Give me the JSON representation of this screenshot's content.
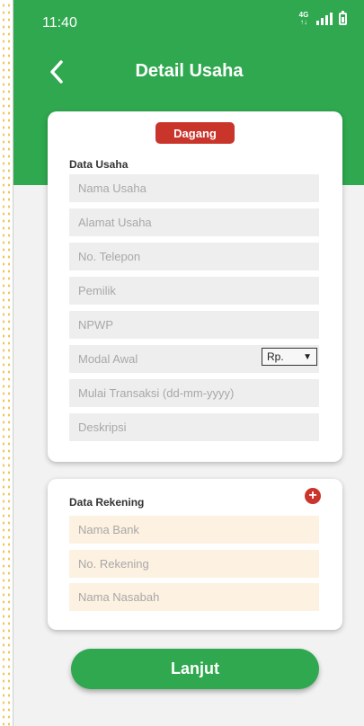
{
  "status_bar": {
    "time": "11:40",
    "network": "4G"
  },
  "header": {
    "title": "Detail Usaha"
  },
  "business_card": {
    "badge": "Dagang",
    "section_title": "Data Usaha",
    "fields": [
      "Nama Usaha",
      "Alamat Usaha",
      "No. Telepon",
      "Pemilik",
      "NPWP",
      "Modal Awal",
      "Mulai Transaksi (dd-mm-yyyy)",
      "Deskripsi"
    ],
    "currency_select": {
      "value": "Rp."
    }
  },
  "bank_card": {
    "section_title": "Data Rekening",
    "fields": [
      "Nama Bank",
      "No. Rekening",
      "Nama Nasabah"
    ]
  },
  "submit_button": {
    "label": "Lanjut"
  },
  "colors": {
    "primary": "#2fa84f",
    "accent": "#c9352b",
    "field_grey": "#eeeeee",
    "field_peach": "#fdf1e1"
  }
}
